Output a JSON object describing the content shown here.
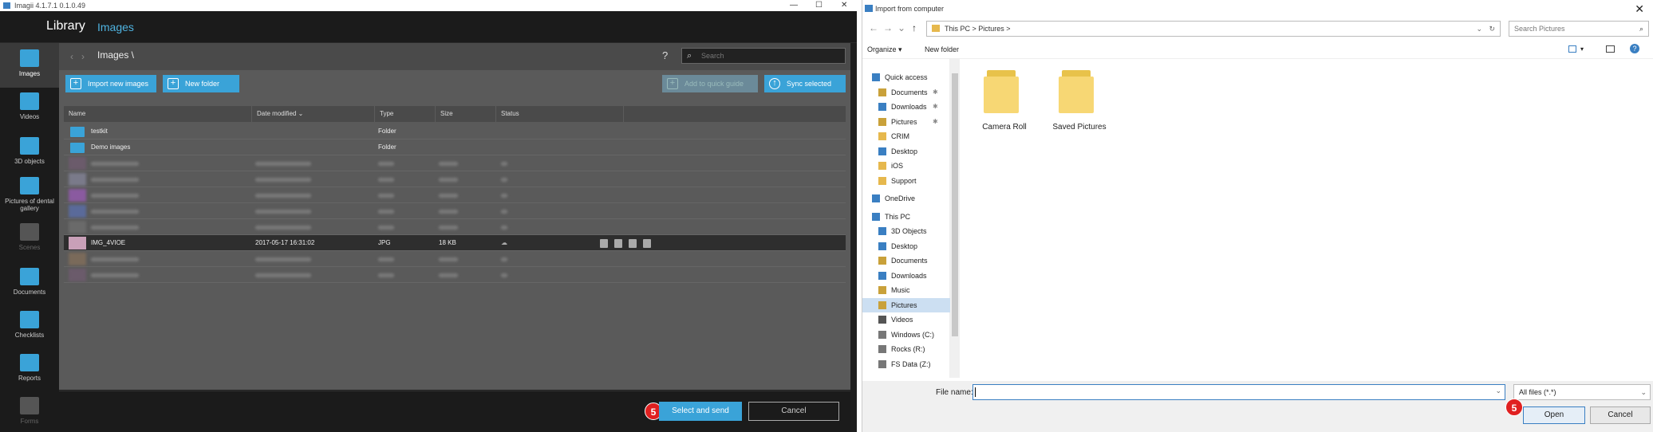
{
  "left": {
    "titlebar": {
      "text": "Imagii 4.1.7.1 0.1.0.49",
      "minimize": "—",
      "maximize": "☐",
      "close": "✕"
    },
    "header": {
      "title": "Library",
      "subtitle": "Images"
    },
    "sidebar": [
      {
        "label": "Images",
        "icon": "images-icon",
        "active": true
      },
      {
        "label": "Videos",
        "icon": "videos-icon"
      },
      {
        "label": "3D objects",
        "icon": "3d-objects-icon"
      },
      {
        "label": "Pictures of dental",
        "label2": "gallery",
        "icon": "gallery-icon"
      },
      {
        "label": "Scenes",
        "icon": "scenes-icon",
        "dim": true
      },
      {
        "label": "Documents",
        "icon": "documents-icon"
      },
      {
        "label": "Checklists",
        "icon": "checklists-icon"
      },
      {
        "label": "Reports",
        "icon": "reports-icon"
      },
      {
        "label": "Forms",
        "icon": "forms-icon",
        "dim": true
      }
    ],
    "toolbar": {
      "breadcrumb": "Images \\",
      "help": "?",
      "search_placeholder": "Search"
    },
    "buttons": {
      "import": "Import new images",
      "new_folder": "New folder",
      "add_quick": "Add to quick guide",
      "sync": "Sync selected"
    },
    "columns": [
      "Name",
      "Date modified",
      "Type",
      "Size",
      "Status"
    ],
    "rows": [
      {
        "name": "testkit",
        "date": "",
        "type": "Folder",
        "size": "",
        "kind": "folder"
      },
      {
        "name": "Demo images",
        "date": "",
        "type": "Folder",
        "size": "",
        "kind": "folder"
      },
      {
        "kind": "blur"
      },
      {
        "kind": "blur"
      },
      {
        "kind": "blur"
      },
      {
        "kind": "blur"
      },
      {
        "kind": "blur"
      },
      {
        "name": "IMG_4VIOE",
        "date": "2017-05-17 16:31:02",
        "type": "JPG",
        "size": "18 KB",
        "kind": "selected"
      },
      {
        "kind": "blur"
      },
      {
        "kind": "blur"
      }
    ],
    "footer": {
      "select": "Select and send",
      "cancel": "Cancel",
      "step": "5"
    }
  },
  "right": {
    "title": "Import from computer",
    "close": "✕",
    "address": "This PC  >  Pictures  >",
    "search_placeholder": "Search Pictures",
    "cmd": {
      "organize": "Organize ▾",
      "new_folder": "New folder"
    },
    "nav": [
      {
        "label": "Quick access",
        "indent": 0,
        "color": "#3a7fc2"
      },
      {
        "label": "Documents",
        "indent": 1,
        "color": "#c9a13a",
        "pin": true
      },
      {
        "label": "Downloads",
        "indent": 1,
        "color": "#3a7fc2",
        "pin": true
      },
      {
        "label": "Pictures",
        "indent": 1,
        "color": "#c9a13a",
        "pin": true
      },
      {
        "label": "CRIM",
        "indent": 1,
        "color": "#e6b84d"
      },
      {
        "label": "Desktop",
        "indent": 1,
        "color": "#3a7fc2"
      },
      {
        "label": "iOS",
        "indent": 1,
        "color": "#e6b84d"
      },
      {
        "label": "Support",
        "indent": 1,
        "color": "#e6b84d"
      },
      {
        "label": "OneDrive",
        "indent": 0,
        "color": "#3a7fc2",
        "gap": true
      },
      {
        "label": "This PC",
        "indent": 0,
        "color": "#3a7fc2",
        "gap": true
      },
      {
        "label": "3D Objects",
        "indent": 1,
        "color": "#3a7fc2"
      },
      {
        "label": "Desktop",
        "indent": 1,
        "color": "#3a7fc2"
      },
      {
        "label": "Documents",
        "indent": 1,
        "color": "#c9a13a"
      },
      {
        "label": "Downloads",
        "indent": 1,
        "color": "#3a7fc2"
      },
      {
        "label": "Music",
        "indent": 1,
        "color": "#c9a13a"
      },
      {
        "label": "Pictures",
        "indent": 1,
        "color": "#c9a13a",
        "sel": true
      },
      {
        "label": "Videos",
        "indent": 1,
        "color": "#555"
      },
      {
        "label": "Windows (C:)",
        "indent": 1,
        "color": "#777"
      },
      {
        "label": "Rocks (R:)",
        "indent": 1,
        "color": "#777"
      },
      {
        "label": "FS Data (Z:)",
        "indent": 1,
        "color": "#777"
      }
    ],
    "folders": [
      "Camera Roll",
      "Saved Pictures"
    ],
    "file_name_label": "File name:",
    "file_type": "All files (*.*)",
    "open": "Open",
    "cancel": "Cancel",
    "step": "5"
  }
}
